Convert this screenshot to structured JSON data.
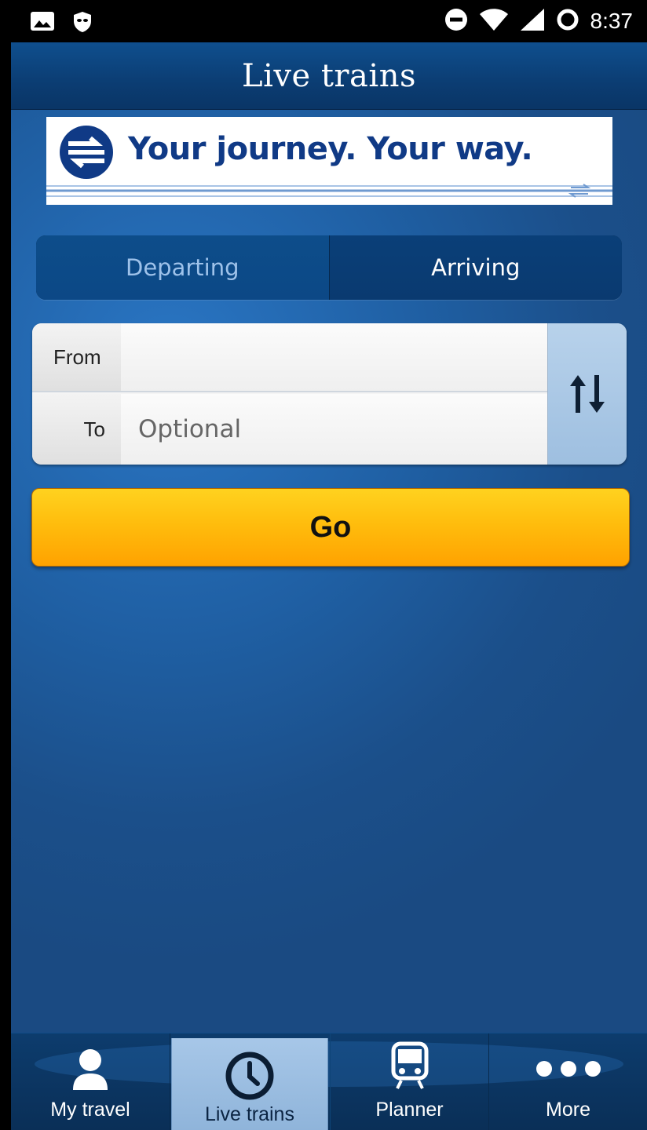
{
  "status_bar": {
    "time": "8:37",
    "left_icons": [
      "image-icon",
      "mask-icon"
    ],
    "right_icons": [
      "do-not-disturb-icon",
      "wifi-icon",
      "cell-signal-icon",
      "battery-ring-icon"
    ]
  },
  "header": {
    "title": "Live trains"
  },
  "banner": {
    "tagline": "Your journey. Your way.",
    "logo": "national-rail-logo"
  },
  "segment": {
    "departing_label": "Departing",
    "arriving_label": "Arriving",
    "selected": "Arriving"
  },
  "form": {
    "from_label": "From",
    "from_value": "",
    "to_label": "To",
    "to_placeholder": "Optional",
    "swap_icon": "swap-arrows-icon"
  },
  "go_button": {
    "label": "Go"
  },
  "tabbar": {
    "tabs": [
      {
        "label": "My travel",
        "icon": "person-icon"
      },
      {
        "label": "Live trains",
        "icon": "clock-icon",
        "selected": true
      },
      {
        "label": "Planner",
        "icon": "train-icon"
      },
      {
        "label": "More",
        "icon": "more-dots-icon"
      }
    ]
  },
  "colors": {
    "header": "#0b3d73",
    "background": "#1f5fa3",
    "go_button": "#ffbd0d",
    "selected_tab": "#a7c7e8",
    "banner_text": "#103a86"
  }
}
